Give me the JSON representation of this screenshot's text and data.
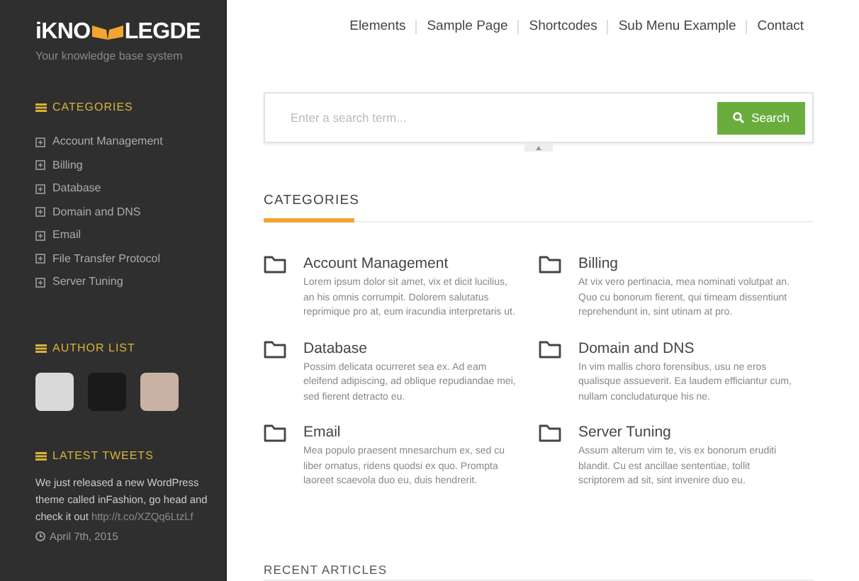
{
  "sidebar": {
    "logo": {
      "left": "iKNO",
      "right": "LEGDE"
    },
    "tagline": "Your knowledge base system",
    "categories": {
      "title": "CATEGORIES",
      "items": [
        {
          "label": "Account Management"
        },
        {
          "label": "Billing"
        },
        {
          "label": "Database"
        },
        {
          "label": "Domain and DNS"
        },
        {
          "label": "Email"
        },
        {
          "label": "File Transfer Protocol"
        },
        {
          "label": "Server Tuning"
        }
      ]
    },
    "authors": {
      "title": "AUTHOR LIST"
    },
    "tweets": {
      "title": "LATEST TWEETS",
      "text": "We just released a new WordPress theme called inFashion, go head and check it out",
      "link": "http://t.co/XZQq6LtzLf",
      "date": "April 7th, 2015"
    }
  },
  "nav": {
    "items": [
      {
        "label": "Elements"
      },
      {
        "label": "Sample Page"
      },
      {
        "label": "Shortcodes"
      },
      {
        "label": "Sub Menu Example"
      },
      {
        "label": "Contact"
      }
    ]
  },
  "search": {
    "placeholder": "Enter a search term...",
    "button": "Search"
  },
  "categories": {
    "title": "CATEGORIES",
    "items": [
      {
        "title": "Account Management",
        "text": "Lorem ipsum dolor sit amet, vix et dicit lucilius, an his omnis corrumpit. Dolorem salutatus reprimique pro at, eum iracundia interpretaris ut."
      },
      {
        "title": "Billing",
        "text": "At vix vero pertinacia, mea nominati volutpat an. Quo cu bonorum fierent, qui timeam dissentiunt reprehendunt in, sint utinam at pro."
      },
      {
        "title": "Database",
        "text": "Possim delicata ocurreret sea ex. Ad eam eleifend adipiscing, ad oblique repudiandae mei, sed fierent detracto eu."
      },
      {
        "title": "Domain and DNS",
        "text": "In vim mallis choro forensibus, usu ne eros qualisque assueverit. Ea laudem efficiantur cum, nullam concludaturque his ne."
      },
      {
        "title": "Email",
        "text": "Mea populo praesent mnesarchum ex, sed cu liber ornatus, ridens quodsi ex quo. Prompta laoreet scaevola duo eu, duis hendrerit."
      },
      {
        "title": "Server Tuning",
        "text": "Assum alterum vim te, vis ex bonorum eruditi blandit. Cu est ancillae sententiae, tollit scriptorem ad sit, sint invenire duo eu."
      }
    ]
  },
  "recent": {
    "title": "RECENT ARTICLES"
  }
}
